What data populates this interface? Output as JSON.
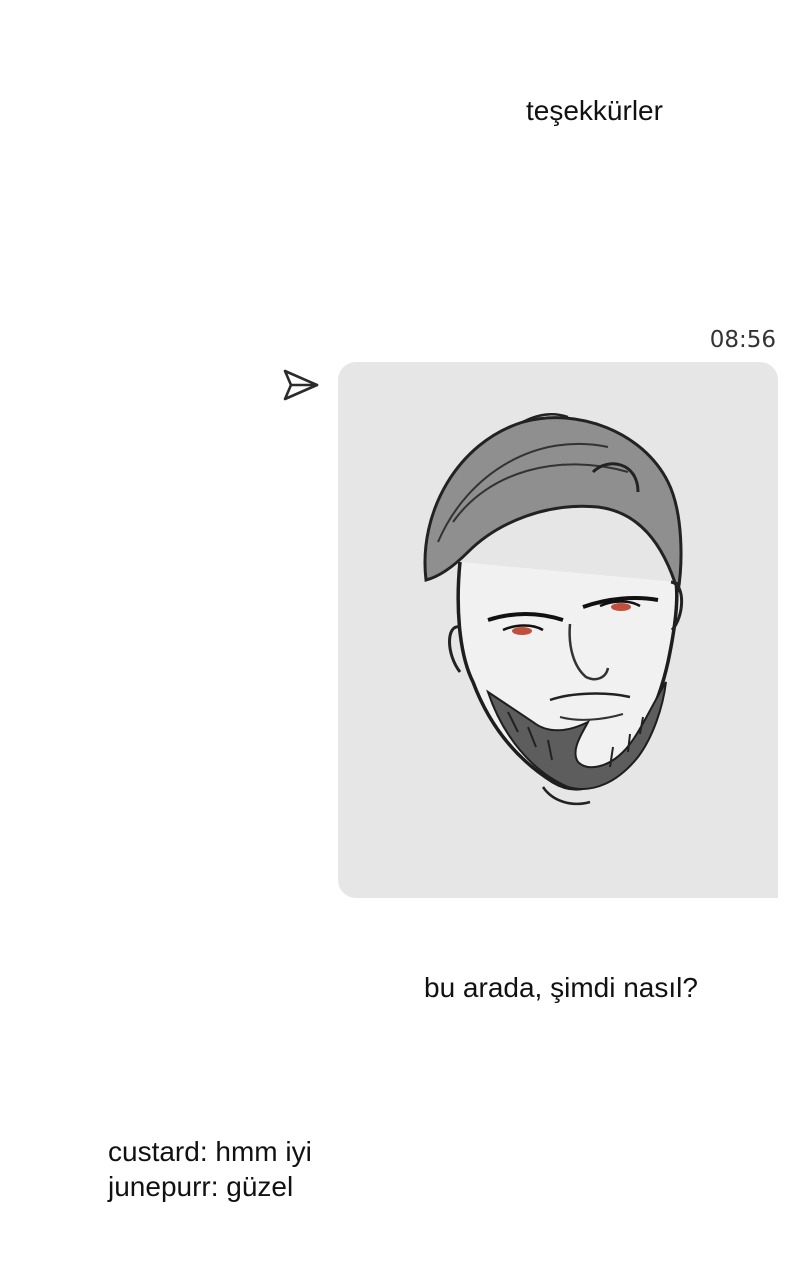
{
  "messages": {
    "thanks": "teşekkürler",
    "followup": "bu arada, şimdi nasıl?"
  },
  "image_message": {
    "timestamp": "08:56",
    "send_icon": "send-icon",
    "content_description_icon": "sketch-portrait-image"
  },
  "chat_lines": [
    {
      "text": "custard: hmm iyi"
    },
    {
      "text": "junepurr: güzel"
    }
  ],
  "colors": {
    "bubble": "#e6e6e6",
    "eye_accent": "#c0503e",
    "text": "#111111"
  }
}
